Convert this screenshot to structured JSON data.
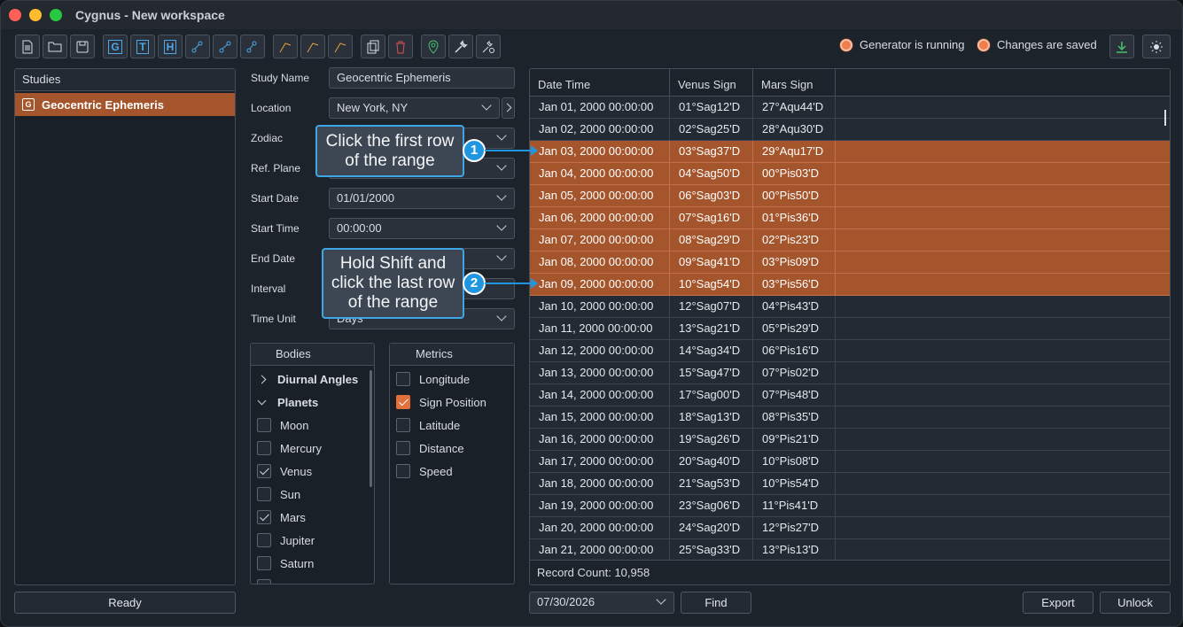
{
  "window": {
    "title": "Cygnus - New workspace"
  },
  "toolbar": {
    "buttons": [
      {
        "label": "",
        "icon": "new-file-icon"
      },
      {
        "label": "",
        "icon": "open-folder-icon"
      },
      {
        "label": "",
        "icon": "save-icon"
      },
      {
        "label": "G",
        "icon": "geocentric-study-icon"
      },
      {
        "label": "T",
        "icon": "topocentric-study-icon"
      },
      {
        "label": "H",
        "icon": "heliocentric-study-icon"
      },
      {
        "label": "",
        "icon": "add-geo-chart-icon"
      },
      {
        "label": "",
        "icon": "add-topo-chart-icon"
      },
      {
        "label": "",
        "icon": "add-helio-chart-icon"
      },
      {
        "label": "",
        "icon": "add-geo-aspect-icon"
      },
      {
        "label": "",
        "icon": "add-topo-aspect-icon"
      },
      {
        "label": "",
        "icon": "add-helio-aspect-icon"
      },
      {
        "label": "",
        "icon": "duplicate-icon"
      },
      {
        "label": "",
        "icon": "delete-icon"
      },
      {
        "label": "",
        "icon": "location-pin-icon"
      },
      {
        "label": "",
        "icon": "wrench-icon"
      },
      {
        "label": "",
        "icon": "settings-icon"
      }
    ],
    "generator_status": "Generator is running",
    "save_status": "Changes are saved",
    "colors": {
      "accent": "#a5552c",
      "status_dot": "#f07d4c",
      "callout": "#2196e0"
    }
  },
  "studies": {
    "title": "Studies",
    "items": [
      {
        "icon_letter": "G",
        "label": "Geocentric Ephemeris"
      }
    ],
    "status_button": "Ready"
  },
  "form": {
    "study_name": {
      "label": "Study Name",
      "value": "Geocentric Ephemeris"
    },
    "location": {
      "label": "Location",
      "value": "New York, NY"
    },
    "zodiac": {
      "label": "Zodiac",
      "value": ""
    },
    "ref_plane": {
      "label": "Ref. Plane",
      "value": ""
    },
    "start_date": {
      "label": "Start Date",
      "value": "01/01/2000"
    },
    "start_time": {
      "label": "Start Time",
      "value": "00:00:00"
    },
    "end_date": {
      "label": "End Date",
      "value": ""
    },
    "interval": {
      "label": "Interval",
      "value": ""
    },
    "time_unit": {
      "label": "Time Unit",
      "value": "Days"
    }
  },
  "bodies": {
    "title": "Bodies",
    "groups": [
      {
        "label": "Diurnal Angles",
        "expanded": false
      },
      {
        "label": "Planets",
        "expanded": true
      }
    ],
    "items": [
      {
        "label": "Moon",
        "checked": false
      },
      {
        "label": "Mercury",
        "checked": false
      },
      {
        "label": "Venus",
        "checked": true
      },
      {
        "label": "Sun",
        "checked": false
      },
      {
        "label": "Mars",
        "checked": true
      },
      {
        "label": "Jupiter",
        "checked": false
      },
      {
        "label": "Saturn",
        "checked": false
      }
    ]
  },
  "metrics": {
    "title": "Metrics",
    "items": [
      {
        "label": "Longitude",
        "checked": false
      },
      {
        "label": "Sign Position",
        "checked": true
      },
      {
        "label": "Latitude",
        "checked": false
      },
      {
        "label": "Distance",
        "checked": false
      },
      {
        "label": "Speed",
        "checked": false
      }
    ]
  },
  "table": {
    "columns": [
      "Date Time",
      "Venus Sign",
      "Mars Sign"
    ],
    "rows": [
      {
        "cells": [
          "Jan 01, 2000 00:00:00",
          "01°Sag12'D",
          "27°Aqu44'D"
        ],
        "selected": false
      },
      {
        "cells": [
          "Jan 02, 2000 00:00:00",
          "02°Sag25'D",
          "28°Aqu30'D"
        ],
        "selected": false
      },
      {
        "cells": [
          "Jan 03, 2000 00:00:00",
          "03°Sag37'D",
          "29°Aqu17'D"
        ],
        "selected": true
      },
      {
        "cells": [
          "Jan 04, 2000 00:00:00",
          "04°Sag50'D",
          "00°Pis03'D"
        ],
        "selected": true
      },
      {
        "cells": [
          "Jan 05, 2000 00:00:00",
          "06°Sag03'D",
          "00°Pis50'D"
        ],
        "selected": true
      },
      {
        "cells": [
          "Jan 06, 2000 00:00:00",
          "07°Sag16'D",
          "01°Pis36'D"
        ],
        "selected": true
      },
      {
        "cells": [
          "Jan 07, 2000 00:00:00",
          "08°Sag29'D",
          "02°Pis23'D"
        ],
        "selected": true
      },
      {
        "cells": [
          "Jan 08, 2000 00:00:00",
          "09°Sag41'D",
          "03°Pis09'D"
        ],
        "selected": true
      },
      {
        "cells": [
          "Jan 09, 2000 00:00:00",
          "10°Sag54'D",
          "03°Pis56'D"
        ],
        "selected": true
      },
      {
        "cells": [
          "Jan 10, 2000 00:00:00",
          "12°Sag07'D",
          "04°Pis43'D"
        ],
        "selected": false
      },
      {
        "cells": [
          "Jan 11, 2000 00:00:00",
          "13°Sag21'D",
          "05°Pis29'D"
        ],
        "selected": false
      },
      {
        "cells": [
          "Jan 12, 2000 00:00:00",
          "14°Sag34'D",
          "06°Pis16'D"
        ],
        "selected": false
      },
      {
        "cells": [
          "Jan 13, 2000 00:00:00",
          "15°Sag47'D",
          "07°Pis02'D"
        ],
        "selected": false
      },
      {
        "cells": [
          "Jan 14, 2000 00:00:00",
          "17°Sag00'D",
          "07°Pis48'D"
        ],
        "selected": false
      },
      {
        "cells": [
          "Jan 15, 2000 00:00:00",
          "18°Sag13'D",
          "08°Pis35'D"
        ],
        "selected": false
      },
      {
        "cells": [
          "Jan 16, 2000 00:00:00",
          "19°Sag26'D",
          "09°Pis21'D"
        ],
        "selected": false
      },
      {
        "cells": [
          "Jan 17, 2000 00:00:00",
          "20°Sag40'D",
          "10°Pis08'D"
        ],
        "selected": false
      },
      {
        "cells": [
          "Jan 18, 2000 00:00:00",
          "21°Sag53'D",
          "10°Pis54'D"
        ],
        "selected": false
      },
      {
        "cells": [
          "Jan 19, 2000 00:00:00",
          "23°Sag06'D",
          "11°Pis41'D"
        ],
        "selected": false
      },
      {
        "cells": [
          "Jan 20, 2000 00:00:00",
          "24°Sag20'D",
          "12°Pis27'D"
        ],
        "selected": false
      },
      {
        "cells": [
          "Jan 21, 2000 00:00:00",
          "25°Sag33'D",
          "13°Pis13'D"
        ],
        "selected": false
      }
    ],
    "record_count_label": "Record Count:",
    "record_count": "10,958"
  },
  "bottom": {
    "find_date": "07/30/2026",
    "find_label": "Find",
    "export_label": "Export",
    "unlock_label": "Unlock"
  },
  "callouts": [
    {
      "number": "1",
      "text": "Click the first row of the range"
    },
    {
      "number": "2",
      "text": "Hold Shift and click the last row of the range"
    }
  ]
}
